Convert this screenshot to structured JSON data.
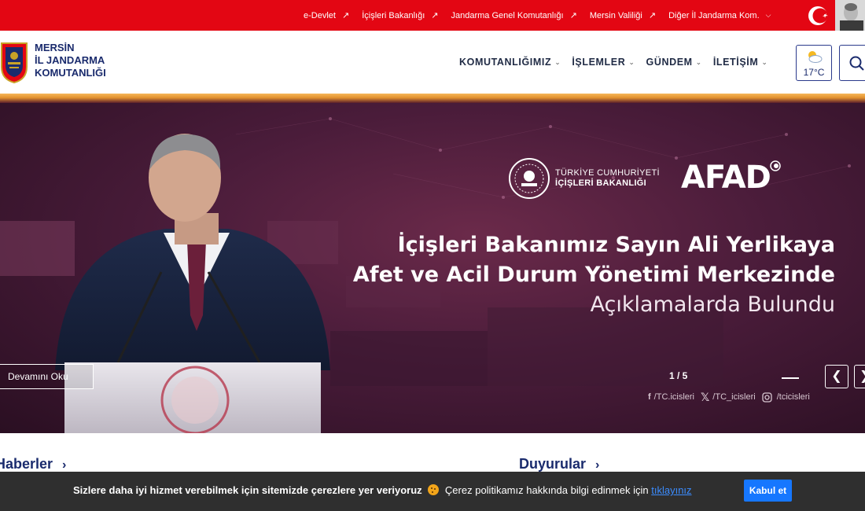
{
  "topbar": {
    "links": [
      {
        "label": "e-Devlet",
        "icon": "external-arrow-icon"
      },
      {
        "label": "İçişleri Bakanlığı",
        "icon": "external-arrow-icon"
      },
      {
        "label": "Jandarma Genel Komutanlığı",
        "icon": "external-arrow-icon"
      },
      {
        "label": "Mersin Valiliği",
        "icon": "external-arrow-icon"
      },
      {
        "label": "Diğer İl Jandarma Kom.",
        "icon": "chevron-down-icon"
      }
    ],
    "arrow_glyph": "↗",
    "chevron_glyph": "⌄"
  },
  "header": {
    "brand_line1": "MERSİN",
    "brand_line2": "İL JANDARMA",
    "brand_line3": "KOMUTANLIĞI",
    "nav": [
      {
        "label": "KOMUTANLIĞIMIZ"
      },
      {
        "label": "İŞLEMLER"
      },
      {
        "label": "GÜNDEM"
      },
      {
        "label": "İLETİŞİM"
      }
    ],
    "weather_temp": "17°C",
    "weather_icon": "partly-cloudy-icon"
  },
  "hero": {
    "ministry_line1": "TÜRKİYE CUMHURİYETİ",
    "ministry_line2": "İÇİŞLERİ BAKANLIĞI",
    "afad_label": "AFAD",
    "title_line1": "İçişleri Bakanımız Sayın Ali Yerlikaya",
    "title_line2": "Afet ve Acil Durum Yönetimi Merkezinde",
    "title_line3": "Açıklamalarda Bulundu",
    "read_more": "Devamını Oku",
    "pager": "1 / 5",
    "social": [
      {
        "icon": "facebook-icon",
        "handle": "/TC.icisleri"
      },
      {
        "icon": "x-twitter-icon",
        "handle": "/TC_icisleri"
      },
      {
        "icon": "instagram-icon",
        "handle": "/tcicisleri"
      }
    ]
  },
  "sections": {
    "news_title": "Haberler",
    "announcements_title": "Duyurular",
    "arrow": "›"
  },
  "cookie": {
    "bold_text": "Sizlere daha iyi hizmet verebilmek için sitemizde çerezlere yer veriyoruz",
    "normal_text": "Çerez politikamız hakkında bilgi edinmek için",
    "link_text": "tıklayınız",
    "accept_label": "Kabul et"
  },
  "colors": {
    "top_red": "#e30613",
    "brand_navy": "#1a2b6d",
    "hero_purple": "#4a1c3a",
    "accept_blue": "#1677ff"
  }
}
